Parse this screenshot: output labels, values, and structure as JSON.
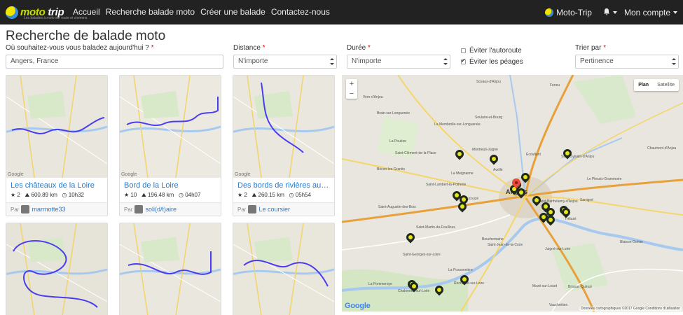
{
  "navbar": {
    "brand": {
      "name_a": "moto",
      "name_b": "trip",
      "tagline": "Les balades à moto sur route et chemins"
    },
    "links": [
      "Accueil",
      "Recherche balade moto",
      "Créer une balade",
      "Contactez-nous"
    ],
    "right_brand": "Moto-Trip",
    "bell_icon": "bell-icon",
    "account": "Mon compte"
  },
  "page": {
    "title": "Recherche de balade moto"
  },
  "form": {
    "where": {
      "label": "Où souhaitez-vous vous baladez aujourd'hui ?",
      "required": "*",
      "value": "Angers, France"
    },
    "distance": {
      "label": "Distance",
      "required": "*",
      "selected": "N'importe"
    },
    "duree": {
      "label": "Durée",
      "required": "*",
      "selected": "N'importe"
    },
    "checks": [
      {
        "label": "Éviter l'autoroute",
        "checked": false
      },
      {
        "label": "Éviter les péages",
        "checked": true
      }
    ],
    "sort": {
      "label": "Trier par",
      "required": "*",
      "selected": "Pertinence"
    }
  },
  "cards": [
    {
      "title": "Les châteaux de la Loire",
      "stars": "2",
      "distance": "600.89 km",
      "time": "10h32",
      "by": "Par",
      "author": "marmotte33"
    },
    {
      "title": "Bord de la Loire",
      "stars": "10",
      "distance": "196.48 km",
      "time": "04h07",
      "by": "Par",
      "author": "soli(d/t)aire"
    },
    {
      "title": "Des bords de rivières aux vig...",
      "stars": "2",
      "distance": "260.15 km",
      "time": "05h54",
      "by": "Par",
      "author": "Le coursier"
    },
    {
      "title": "",
      "stars": "",
      "distance": "",
      "time": "",
      "by": "",
      "author": ""
    },
    {
      "title": "",
      "stars": "",
      "distance": "",
      "time": "",
      "by": "",
      "author": ""
    },
    {
      "title": "",
      "stars": "",
      "distance": "",
      "time": "",
      "by": "",
      "author": ""
    }
  ],
  "thumb_google": "Google",
  "map": {
    "types": [
      "Plan",
      "Satellite"
    ],
    "zoom_in": "+",
    "zoom_out": "−",
    "google": "Google",
    "footer": "Données cartographiques ©2017 Google   Conditions d'utilisation",
    "city": "Angers",
    "towns": [
      "Sceaux-d'Anjou",
      "Feneu",
      "Vern-d'Anjou",
      "Brain-sur-Longuenée",
      "La Membrolle-sur-Longuenée",
      "Soulaire-et-Bourg",
      "La Pouëze",
      "Montreuil-Juigné",
      "Saint-Clément-de-la-Place",
      "Écouflant",
      "Saint-Sylvain-d'Anjou",
      "Bécon-les-Granits",
      "Avrillé",
      "La Meignanne",
      "Saint-Lambert-la-Potherie",
      "Beaucouzé",
      "Saint-Augustin-des-Bois",
      "Saint-Barthélemy-d'Anjou",
      "Trélazé",
      "Saint-Martin-du-Fouilloux",
      "Bouchemaine",
      "Saint-Jean-de-la-Croix",
      "Juigné-sur-Loire",
      "Saint-Georges-sur-Loire",
      "La Possonnière",
      "Chalonnes-sur-Loire",
      "Rochefort-sur-Loire",
      "Mozé-sur-Louet",
      "Brissac-Quincé",
      "Vauchrétien",
      "Le Plessis-Grammoire",
      "Chaumont-d'Anjou",
      "Blaison-Gohier",
      "La Pommeraye",
      "Sarrigné"
    ]
  },
  "colors": {
    "navbar": "#222222",
    "link": "#2a7ac8",
    "required": "#ee0000",
    "route": "#4a3df0"
  }
}
